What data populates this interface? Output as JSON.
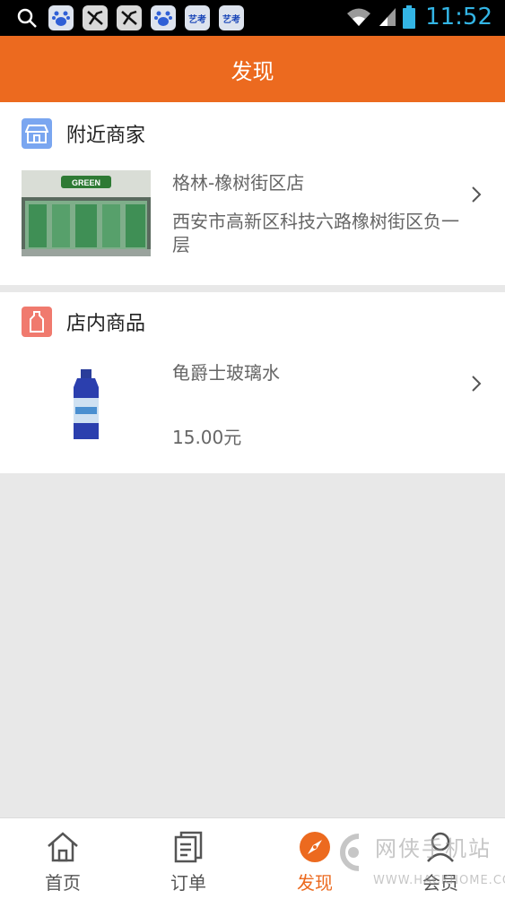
{
  "status_bar": {
    "time": "11:52",
    "icons": [
      "search-icon",
      "baidu-icon",
      "app-icon",
      "app-icon",
      "baidu-icon",
      "yikao-icon",
      "yikao-icon",
      "wifi-icon",
      "signal-icon",
      "battery-icon"
    ],
    "app_label_1": "艺考",
    "app_label_2": "艺考"
  },
  "header": {
    "title": "发现"
  },
  "nearby": {
    "title": "附近商家",
    "item": {
      "name": "格林-橡树街区店",
      "address": "西安市高新区科技六路橡树街区负一层",
      "image_text": "GREEN"
    }
  },
  "products": {
    "title": "店内商品",
    "item": {
      "name": "龟爵士玻璃水",
      "price": "15.00元"
    }
  },
  "tabs": [
    {
      "label": "首页",
      "icon": "home-icon",
      "active": false
    },
    {
      "label": "订单",
      "icon": "orders-icon",
      "active": false
    },
    {
      "label": "发现",
      "icon": "compass-icon",
      "active": true
    },
    {
      "label": "会员",
      "icon": "user-icon",
      "active": false
    }
  ],
  "watermark": {
    "text": "网侠手机站",
    "url": "WWW.HACKHOME.COM"
  },
  "colors": {
    "accent": "#ec6a1f",
    "status_time": "#33b5e5",
    "nearby_icon": "#7aa6f0",
    "product_icon": "#f07a6e"
  }
}
